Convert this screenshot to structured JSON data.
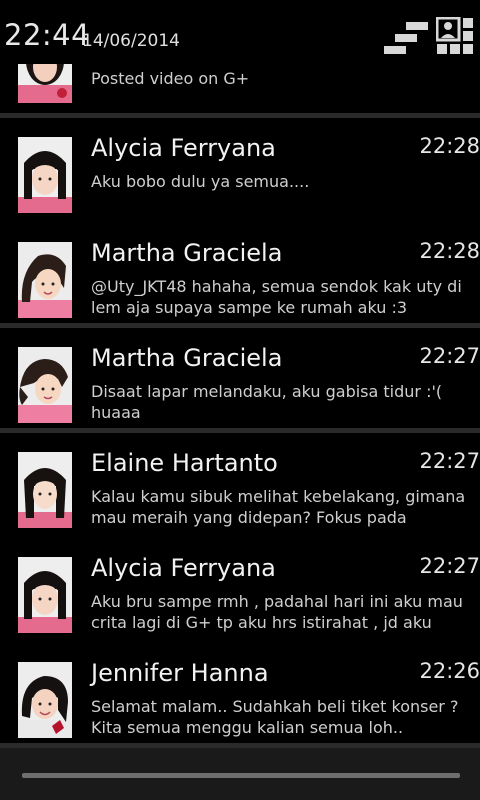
{
  "status": {
    "time": "22:44",
    "date": "14/06/2014"
  },
  "header_icons": {
    "clear": "clear-all-icon",
    "settings": "quick-settings-icon"
  },
  "notifications": [
    {
      "name": "",
      "time": "",
      "message": "Posted video on G+"
    },
    {
      "name": "Alycia Ferryana",
      "time": "22:28",
      "message": "Aku bobo dulu ya semua....\n\nI love you :****"
    },
    {
      "name": "Martha Graciela",
      "time": "22:28",
      "message": "@Uty_JKT48 hahaha, semua sendok kak uty di lem aja supaya sampe ke rumah aku :3"
    },
    {
      "name": "Martha Graciela",
      "time": "22:27",
      "message": "Disaat lapar melandaku, aku gabisa tidur :'( huaaa"
    },
    {
      "name": "Elaine Hartanto",
      "time": "22:27",
      "message": "Kalau kamu sibuk melihat kebelakang, gimana mau meraih yang didepan? Fokus pada tujuanmu, bukan pada kesalahanmu"
    },
    {
      "name": "Alycia Ferryana",
      "time": "22:27",
      "message": "Aku bru sampe rmh , padahal hari ini aku mau crita lagi di G+ tp aku hrs istirahat , jd aku kasih foto waktu kecil :p http://t.co/DzuIGBnuQG"
    },
    {
      "name": "Jennifer Hanna",
      "time": "22:26",
      "message": "Selamat malam.. Sudahkah beli tiket konser ? Kita semua menggu kalian semua loh.."
    }
  ],
  "colors": {
    "background": "#000000",
    "separator": "#2a2a2a",
    "nav_bar": "#1a1a1a",
    "handle": "#6e6e6e"
  }
}
